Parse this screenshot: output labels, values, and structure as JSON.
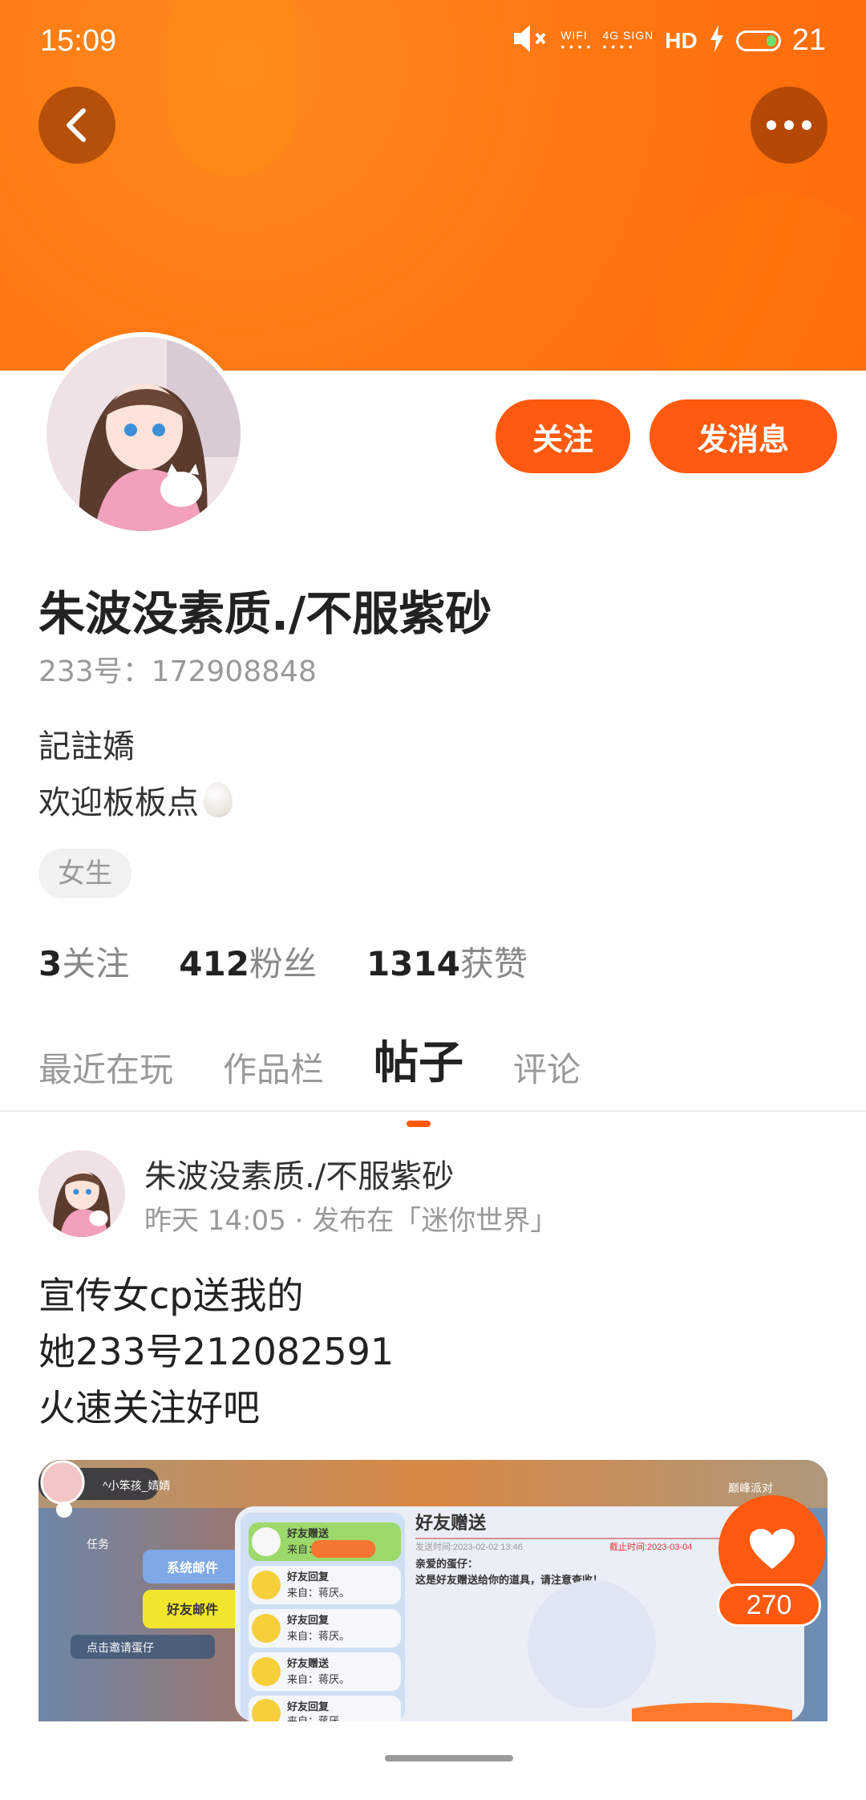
{
  "status_bar": {
    "time": "15:09",
    "wifi_label": "WIFI",
    "signal_label": "4G SIGN",
    "hd_label": "HD",
    "battery": "21",
    "icons": [
      "mute-icon",
      "wifi-icon",
      "signal-icon",
      "hd-call-icon",
      "charging-icon",
      "battery-icon"
    ]
  },
  "header": {
    "back_icon": "back-arrow-icon",
    "more_icon": "more-dots-icon"
  },
  "profile": {
    "follow_label": "关注",
    "message_label": "发消息",
    "username": "朱波没素质./不服紫砂",
    "uid": "233号：172908848",
    "bio_line1": "記註嬌",
    "bio_line2": "欢迎板板点",
    "gender_tag": "女生",
    "stats": {
      "following_count": "3",
      "following_label": "关注",
      "fans_count": "412",
      "fans_label": "粉丝",
      "likes_count": "1314",
      "likes_label": "获赞"
    }
  },
  "tabs": [
    {
      "label": "最近在玩"
    },
    {
      "label": "作品栏"
    },
    {
      "label": "帖子",
      "active": true
    },
    {
      "label": "评论"
    }
  ],
  "post": {
    "author": "朱波没素质./不服紫砂",
    "meta": "昨天 14:05 · 发布在「迷你世界」",
    "text_lines": [
      "宣传女cp送我的",
      "她233号212082591",
      "火速关注好吧"
    ],
    "like_count": "270",
    "image": {
      "player_name": "^小笨孩_婧婧",
      "panel_title": "好友赠送",
      "send_time": "发送时间:2023-02-02 13:46",
      "expire_time": "截止时间:2023-03-04",
      "greeting": "亲爱的蛋仔：",
      "message": "这是好友赠送给你的道具，请注意查收！",
      "tab_system": "系统邮件",
      "tab_friend": "好友邮件",
      "invite_text": "点击邀请蛋仔",
      "party_text": "巅峰派对",
      "task_text": "任务",
      "list": [
        {
          "title": "好友赠送",
          "from": "来自："
        },
        {
          "title": "好友回复",
          "from": "来自：蒋厌。"
        },
        {
          "title": "好友回复",
          "from": "来自：蒋厌。"
        },
        {
          "title": "好友赠送",
          "from": "来自：蒋厌。"
        },
        {
          "title": "好友回复",
          "from": "来自：蒋厌。"
        }
      ]
    }
  },
  "colors": {
    "accent": "#ff5a10",
    "banner": "#ff7a12"
  }
}
